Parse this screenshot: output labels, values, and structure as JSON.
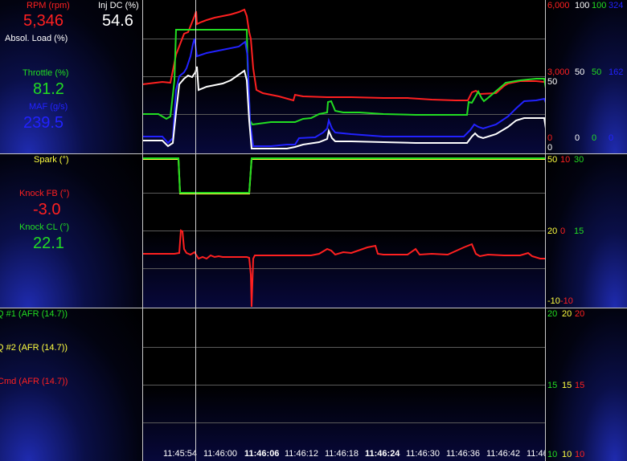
{
  "colors": {
    "red": "#ff2020",
    "white": "#ffffff",
    "green": "#22dd22",
    "blue": "#2222ff",
    "yellow": "#ffff40",
    "tan": "#d2c890"
  },
  "panel1": {
    "rpm": {
      "label": "RPM (rpm)",
      "value": "5,346"
    },
    "inj": {
      "label": "Inj DC (%)",
      "value": "54.6"
    },
    "load": {
      "label": "Absol. Load (%)"
    },
    "throttle": {
      "label": "Throttle (%)",
      "value": "81.2"
    },
    "maf": {
      "label": "MAF (g/s)",
      "value": "239.5"
    },
    "scale": {
      "top": [
        "6,000",
        "100",
        "100",
        "324"
      ],
      "mid": [
        "3,000",
        "50",
        "50",
        "162"
      ],
      "mid_white": "50",
      "bot": [
        "0",
        "0",
        "0",
        "0"
      ],
      "bot_white": "0"
    }
  },
  "panel2": {
    "spark": {
      "label": "Spark (°)"
    },
    "knockfb": {
      "label": "Knock FB (°)",
      "value": "-3.0"
    },
    "knockcl": {
      "label": "Knock CL (°)",
      "value": "22.1"
    },
    "scale": {
      "top": [
        "50",
        "10",
        "30"
      ],
      "mid": [
        "20",
        "0",
        "15"
      ],
      "bot": [
        "-10",
        "-10"
      ]
    }
  },
  "panel3": {
    "afr1": {
      "label": "Q #1 (AFR (14.7))"
    },
    "afr2": {
      "label": "Q #2 (AFR (14.7))"
    },
    "afrcmd": {
      "label": "Cmd (AFR (14.7))"
    },
    "scale": {
      "top": [
        "20",
        "20",
        "20"
      ],
      "mid": [
        "15",
        "15",
        "15"
      ],
      "bot": [
        "10",
        "10",
        "10"
      ]
    }
  },
  "time_axis": [
    "11:45:54",
    "11:46:00",
    "11:46:06",
    "11:46:12",
    "11:46:18",
    "11:46:24",
    "11:46:30",
    "11:46:36",
    "11:46:42",
    "11:46"
  ],
  "time_axis_bold": [
    "11:46:06",
    "11:46:24"
  ]
}
